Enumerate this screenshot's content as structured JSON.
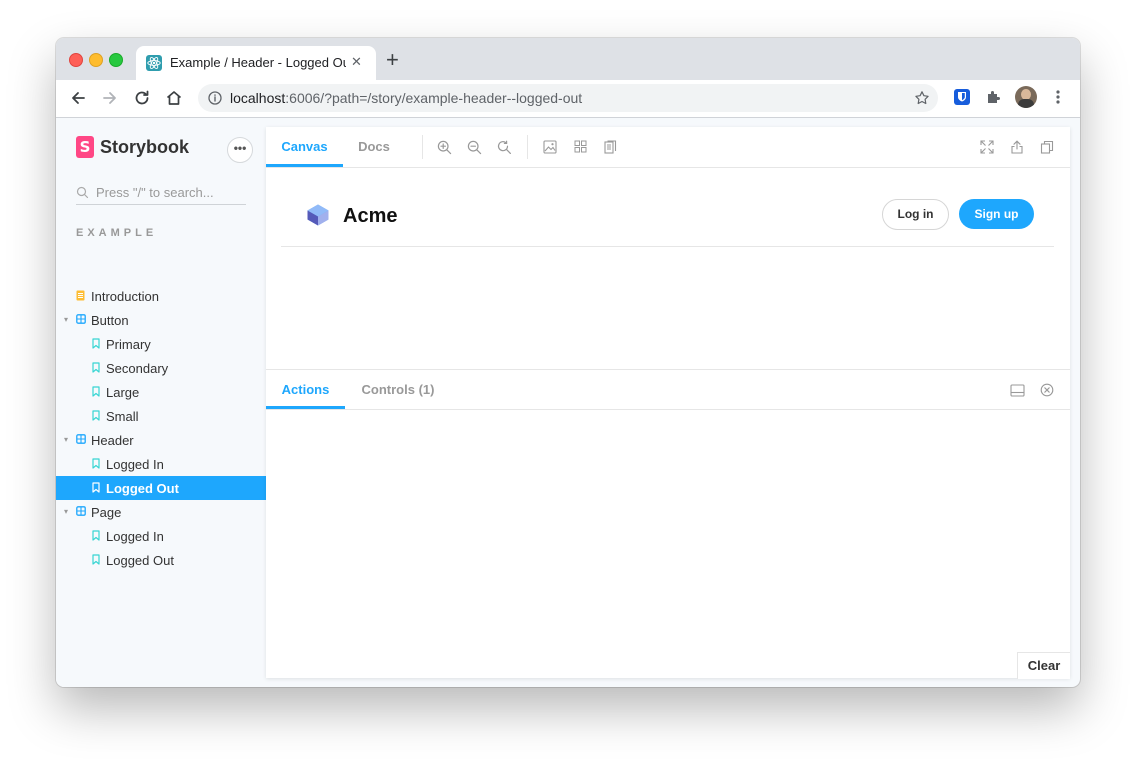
{
  "browser": {
    "tab_title": "Example / Header - Logged Out",
    "tab_close": "✕",
    "new_tab": "+",
    "url_host": "localhost",
    "url_rest": ":6006/?path=/story/example-header--logged-out"
  },
  "sidebar": {
    "brand": "Storybook",
    "logo_letter": "S",
    "menu_label": "•••",
    "search_placeholder": "Press \"/\" to search...",
    "section": "EXAMPLE",
    "items": [
      {
        "label": "Introduction",
        "kind": "document-icon"
      },
      {
        "label": "Button",
        "kind": "component-icon"
      },
      {
        "label": "Primary",
        "kind": "bookmark-icon"
      },
      {
        "label": "Secondary",
        "kind": "bookmark-icon"
      },
      {
        "label": "Large",
        "kind": "bookmark-icon"
      },
      {
        "label": "Small",
        "kind": "bookmark-icon"
      },
      {
        "label": "Header",
        "kind": "component-icon"
      },
      {
        "label": "Logged In",
        "kind": "bookmark-icon"
      },
      {
        "label": "Logged Out",
        "kind": "bookmark-icon",
        "selected": true
      },
      {
        "label": "Page",
        "kind": "component-icon"
      },
      {
        "label": "Logged In",
        "kind": "bookmark-icon"
      },
      {
        "label": "Logged Out",
        "kind": "bookmark-icon"
      }
    ]
  },
  "toolbar": {
    "tabs": [
      "Canvas",
      "Docs"
    ]
  },
  "preview": {
    "brand": "Acme",
    "login_label": "Log in",
    "signup_label": "Sign up"
  },
  "addons": {
    "tabs": [
      "Actions",
      "Controls (1)"
    ],
    "clear_label": "Clear"
  },
  "colors": {
    "accent": "#1ea7fd",
    "storybook_pink": "#ff4785"
  }
}
